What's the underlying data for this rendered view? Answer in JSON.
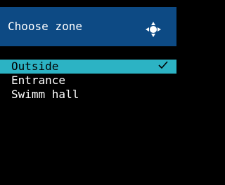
{
  "header": {
    "title": "Choose zone",
    "nav_icon": "dpad-navigation-icon"
  },
  "zones": {
    "items": [
      {
        "label": "Outside",
        "selected": true
      },
      {
        "label": "Entrance",
        "selected": false
      },
      {
        "label": "Swimm hall",
        "selected": false
      }
    ]
  },
  "colors": {
    "header_bg": "#0d4a84",
    "selected_bg": "#2cb3c4",
    "background": "#000000"
  }
}
